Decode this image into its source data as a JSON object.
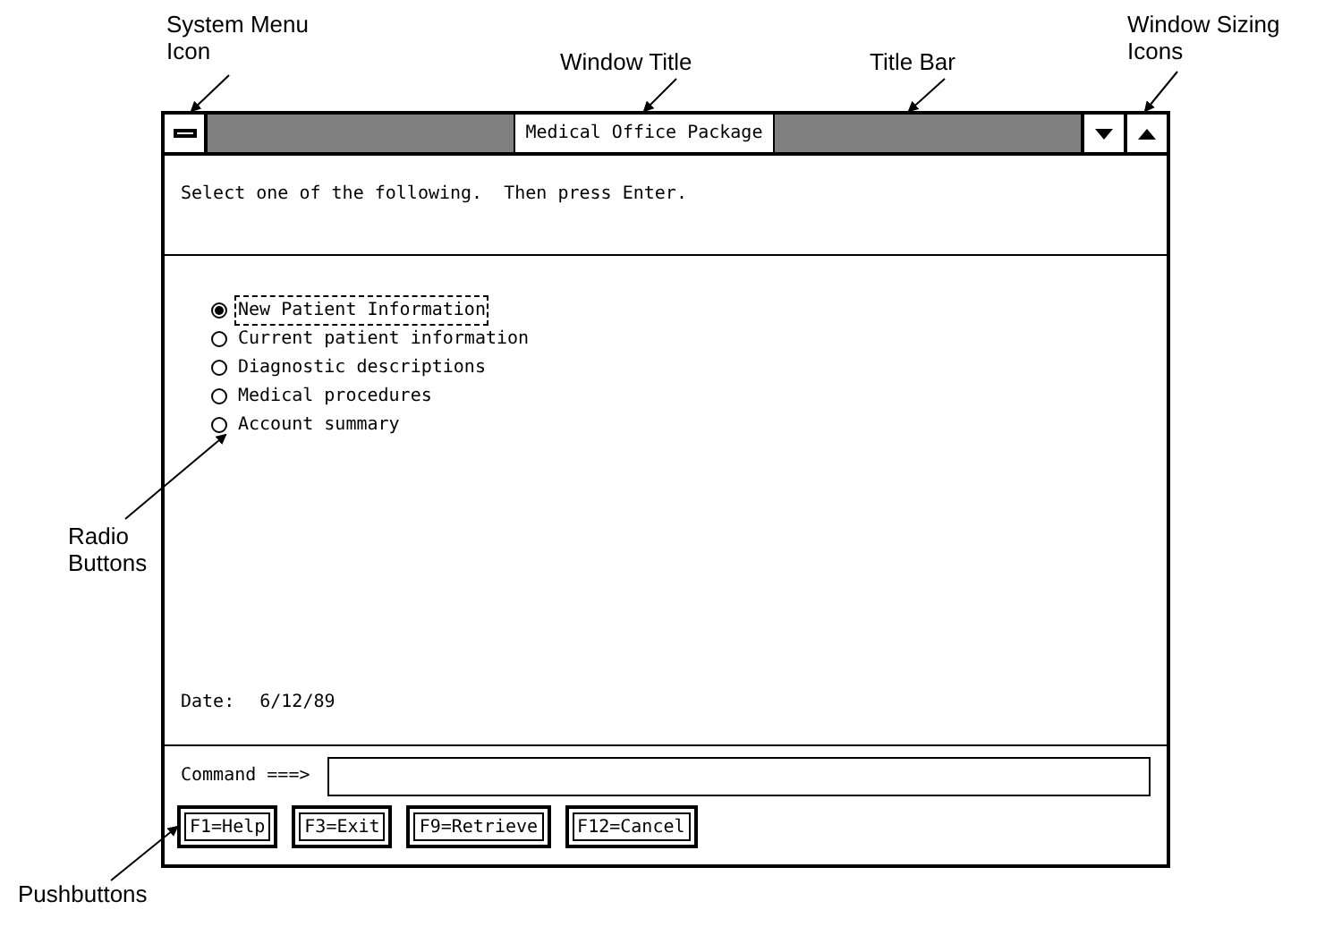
{
  "annotations": [
    {
      "lines": [
        "System Menu",
        "Icon"
      ]
    },
    {
      "lines": [
        "Window Title"
      ]
    },
    {
      "lines": [
        "Title Bar"
      ]
    },
    {
      "lines": [
        "Window Sizing",
        "Icons"
      ]
    },
    {
      "lines": [
        "Radio",
        "Buttons"
      ]
    },
    {
      "lines": [
        "Pushbuttons"
      ]
    }
  ],
  "window": {
    "title": "Medical Office Package"
  },
  "instruction": "Select one of the following.  Then press Enter.",
  "options": [
    {
      "label": "New Patient Information",
      "selected": true
    },
    {
      "label": "Current patient information",
      "selected": false
    },
    {
      "label": "Diagnostic descriptions",
      "selected": false
    },
    {
      "label": "Medical procedures",
      "selected": false
    },
    {
      "label": "Account summary",
      "selected": false
    }
  ],
  "date": {
    "label": "Date:",
    "value": "6/12/89"
  },
  "command": {
    "label": "Command ===>"
  },
  "buttons": [
    "F1=Help",
    "F3=Exit",
    "F9=Retrieve",
    "F12=Cancel"
  ]
}
